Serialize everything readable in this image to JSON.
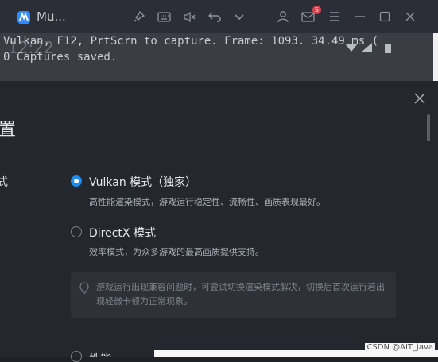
{
  "window": {
    "app_title": "Mu...",
    "notification_count": "5",
    "icons": [
      "pin-icon",
      "keyboard-icon",
      "mute-icon",
      "undo-icon",
      "chevron-down-icon",
      "user-icon",
      "mail-icon",
      "menu-icon",
      "minimize-icon",
      "maximize-icon",
      "close-icon"
    ]
  },
  "console": {
    "line1": "Vulkan, F12, PrtScrn to capture. Frame: 1093. 34.49 ms (",
    "line2": "0 Captures saved.",
    "time": "12:22"
  },
  "dialog": {
    "title": "置",
    "section_label": "式",
    "options": [
      {
        "label": "Vulkan 模式（独家）",
        "desc": "高性能渲染模式，游戏运行稳定性、流畅性、画质表现最好。",
        "selected": true
      },
      {
        "label": "DirectX 模式",
        "desc": "效率模式，为众多游戏的最高画质提供支持。",
        "selected": false
      }
    ],
    "tip": "游戏运行出现兼容问题时，可尝试切换渲染模式解决，切换后首次运行若出现轻微卡顿为正常现象。",
    "partial_option": "性能"
  },
  "watermark": "CSDN @AIT_java",
  "colors": {
    "accent": "#1b8cf2",
    "dialog_bg": "#24272d",
    "badge": "#d8404a"
  }
}
